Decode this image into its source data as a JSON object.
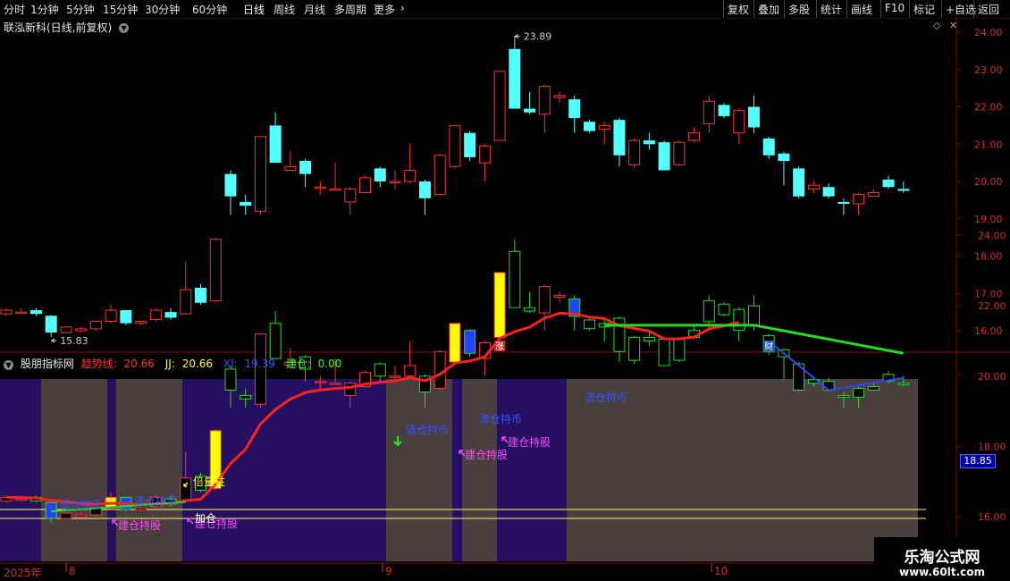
{
  "toolbar": {
    "periods": [
      "分时",
      "1分钟",
      "5分钟",
      "15分钟",
      "30分钟",
      "60分钟",
      "日线",
      "周线",
      "月线",
      "多周期",
      "更多"
    ],
    "active_period": "日线",
    "more_arrow": "›",
    "right_buttons": [
      "复权",
      "叠加",
      "多股",
      "统计",
      "画线",
      "F10",
      "标记",
      "+自选",
      "返回"
    ]
  },
  "main_chart": {
    "title": "联泓新科(日线,前复权)",
    "high_label": "23.89",
    "low_label": "15.83",
    "y_ticks": [
      "24.00",
      "23.00",
      "22.00",
      "21.00",
      "20.00",
      "19.00",
      "18.00",
      "17.00",
      "16.00"
    ],
    "event_markers": [
      {
        "text": "涨",
        "color": "#cc2222"
      },
      {
        "text": "财",
        "color": "#2255cc"
      }
    ]
  },
  "indicator": {
    "name": "股朋指标网",
    "trend_label": "趋势线:",
    "trend_value": "20.66",
    "jj_label": "JJ:",
    "jj_value": "20.66",
    "xj_label": "XJ:",
    "xj_value": "19.39",
    "jc_label": "建仓:",
    "jc_value": "0.00",
    "y_ticks": [
      "24.00",
      "22.00",
      "20.00",
      "18.00",
      "16.00"
    ],
    "price_badge": "18.85",
    "signals": {
      "clear": "清仓持币",
      "build": "建仓持股",
      "double_volume": "倍量柱",
      "add": "加仓"
    }
  },
  "time_axis": {
    "year_label": "2025年",
    "months": [
      "8",
      "9",
      "10"
    ]
  },
  "watermark": {
    "title": "乐淘公式网",
    "url": "www.60lt.com"
  },
  "colors": {
    "up": "#ff3333",
    "down": "#54ffff",
    "trend_line": "#ff2020",
    "green_line": "#22dd22",
    "blue_line": "#3344ff",
    "bg_purple": "#24105e",
    "bg_gray": "#4a3e3e"
  },
  "chart_data": {
    "type": "candlestick",
    "y_axis": [
      15.6,
      24.3
    ],
    "candles": [
      {
        "o": 16.45,
        "c": 16.55,
        "h": 16.6,
        "l": 16.4
      },
      {
        "o": 16.5,
        "c": 16.5,
        "h": 16.6,
        "l": 16.45
      },
      {
        "o": 16.55,
        "c": 16.45,
        "h": 16.6,
        "l": 16.4
      },
      {
        "o": 16.4,
        "c": 15.95,
        "h": 16.42,
        "l": 15.83
      },
      {
        "o": 15.95,
        "c": 16.1,
        "h": 16.12,
        "l": 15.95
      },
      {
        "o": 16.0,
        "c": 16.05,
        "h": 16.1,
        "l": 15.95
      },
      {
        "o": 16.05,
        "c": 16.25,
        "h": 16.27,
        "l": 16.0
      },
      {
        "o": 16.25,
        "c": 16.55,
        "h": 16.7,
        "l": 16.2
      },
      {
        "o": 16.55,
        "c": 16.2,
        "h": 16.56,
        "l": 16.15
      },
      {
        "o": 16.2,
        "c": 16.25,
        "h": 16.27,
        "l": 16.15
      },
      {
        "o": 16.3,
        "c": 16.55,
        "h": 16.6,
        "l": 16.25
      },
      {
        "o": 16.5,
        "c": 16.35,
        "h": 16.6,
        "l": 16.3
      },
      {
        "o": 16.45,
        "c": 17.1,
        "h": 17.85,
        "l": 16.45
      },
      {
        "o": 17.15,
        "c": 16.75,
        "h": 17.25,
        "l": 16.7
      },
      {
        "o": 16.8,
        "c": 18.45,
        "h": 18.5,
        "l": 16.75
      },
      {
        "o": 20.2,
        "c": 19.6,
        "h": 20.3,
        "l": 19.1
      },
      {
        "o": 19.45,
        "c": 19.35,
        "h": 19.65,
        "l": 19.1
      },
      {
        "o": 19.2,
        "c": 21.2,
        "h": 21.2,
        "l": 19.1
      },
      {
        "o": 21.5,
        "c": 20.5,
        "h": 21.85,
        "l": 20.5
      },
      {
        "o": 20.3,
        "c": 20.4,
        "h": 20.8,
        "l": 20.3
      },
      {
        "o": 20.55,
        "c": 20.2,
        "h": 20.6,
        "l": 19.85
      },
      {
        "o": 19.85,
        "c": 19.85,
        "h": 20.0,
        "l": 19.65
      },
      {
        "o": 19.8,
        "c": 19.8,
        "h": 20.5,
        "l": 19.8
      },
      {
        "o": 19.45,
        "c": 19.8,
        "h": 19.85,
        "l": 19.1
      },
      {
        "o": 19.7,
        "c": 20.1,
        "h": 20.15,
        "l": 19.7
      },
      {
        "o": 20.35,
        "c": 20.0,
        "h": 20.4,
        "l": 19.85
      },
      {
        "o": 20.0,
        "c": 20.0,
        "h": 20.3,
        "l": 19.8
      },
      {
        "o": 20.0,
        "c": 20.3,
        "h": 21.0,
        "l": 19.95
      },
      {
        "o": 20.0,
        "c": 19.55,
        "h": 20.05,
        "l": 19.1
      },
      {
        "o": 19.65,
        "c": 20.7,
        "h": 20.75,
        "l": 19.6
      },
      {
        "o": 20.4,
        "c": 21.5,
        "h": 21.5,
        "l": 20.35
      },
      {
        "o": 21.3,
        "c": 20.65,
        "h": 21.35,
        "l": 20.55
      },
      {
        "o": 20.5,
        "c": 20.95,
        "h": 21.0,
        "l": 20.0
      },
      {
        "o": 21.1,
        "c": 22.95,
        "h": 22.95,
        "l": 21.1
      },
      {
        "o": 23.55,
        "c": 21.95,
        "h": 23.89,
        "l": 21.95
      },
      {
        "o": 21.95,
        "c": 21.85,
        "h": 22.4,
        "l": 21.8
      },
      {
        "o": 21.8,
        "c": 22.55,
        "h": 22.6,
        "l": 21.3
      },
      {
        "o": 22.25,
        "c": 22.3,
        "h": 22.4,
        "l": 22.1
      },
      {
        "o": 22.2,
        "c": 21.7,
        "h": 22.3,
        "l": 21.3
      },
      {
        "o": 21.6,
        "c": 21.35,
        "h": 21.65,
        "l": 21.3
      },
      {
        "o": 21.4,
        "c": 21.5,
        "h": 21.6,
        "l": 21.0
      },
      {
        "o": 21.65,
        "c": 20.7,
        "h": 21.7,
        "l": 20.4
      },
      {
        "o": 20.45,
        "c": 21.1,
        "h": 21.15,
        "l": 20.35
      },
      {
        "o": 21.1,
        "c": 21.0,
        "h": 21.3,
        "l": 20.85
      },
      {
        "o": 21.05,
        "c": 20.3,
        "h": 21.1,
        "l": 20.3
      },
      {
        "o": 20.45,
        "c": 21.05,
        "h": 21.1,
        "l": 20.4
      },
      {
        "o": 21.1,
        "c": 21.3,
        "h": 21.45,
        "l": 21.05
      },
      {
        "o": 21.55,
        "c": 22.15,
        "h": 22.3,
        "l": 21.3
      },
      {
        "o": 22.05,
        "c": 21.75,
        "h": 22.1,
        "l": 21.7
      },
      {
        "o": 21.3,
        "c": 21.9,
        "h": 21.95,
        "l": 21.0
      },
      {
        "o": 22.0,
        "c": 21.45,
        "h": 22.3,
        "l": 21.3
      },
      {
        "o": 21.15,
        "c": 20.7,
        "h": 21.2,
        "l": 20.6
      },
      {
        "o": 20.75,
        "c": 20.55,
        "h": 20.8,
        "l": 19.9
      },
      {
        "o": 20.35,
        "c": 19.6,
        "h": 20.4,
        "l": 19.55
      },
      {
        "o": 19.8,
        "c": 19.9,
        "h": 20.0,
        "l": 19.7
      },
      {
        "o": 19.85,
        "c": 19.6,
        "h": 19.95,
        "l": 19.55
      },
      {
        "o": 19.45,
        "c": 19.4,
        "h": 19.55,
        "l": 19.1
      },
      {
        "o": 19.4,
        "c": 19.65,
        "h": 19.7,
        "l": 19.1
      },
      {
        "o": 19.6,
        "c": 19.7,
        "h": 19.8,
        "l": 19.6
      },
      {
        "o": 20.05,
        "c": 19.85,
        "h": 20.15,
        "l": 19.8
      },
      {
        "o": 19.8,
        "c": 19.75,
        "h": 20.0,
        "l": 19.7
      }
    ]
  }
}
